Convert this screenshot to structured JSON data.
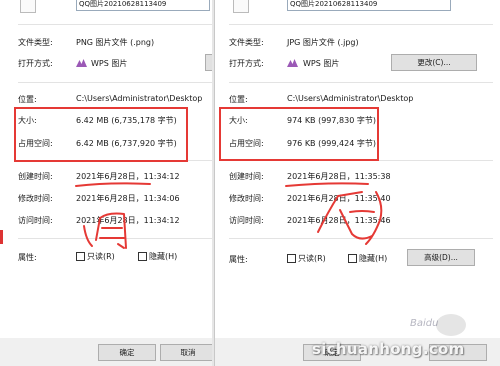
{
  "colors": {
    "annotation": "#e53935",
    "dialog_bg": "#ffffff",
    "button_bg": "#e1e1e1"
  },
  "left": {
    "filename": "QQ图片20210628113409",
    "type_label": "文件类型:",
    "type_value": "PNG 图片文件 (.png)",
    "openwith_label": "打开方式:",
    "openwith_value": "WPS 图片",
    "openwith_icon": "wps-picture-icon",
    "location_label": "位置:",
    "location_value": "C:\\Users\\Administrator\\Desktop",
    "size_label": "大小:",
    "size_value": "6.42 MB (6,735,178 字节)",
    "disk_label": "占用空间:",
    "disk_value": "6.42 MB (6,737,920 字节)",
    "created_label": "创建时间:",
    "created_value": "2021年6月28日，11:34:12",
    "modified_label": "修改时间:",
    "modified_value": "2021年6月28日，11:34:06",
    "accessed_label": "访问时间:",
    "accessed_value": "2021年6月28日，11:34:12",
    "attr_label": "属性:",
    "readonly_label": "只读(R)",
    "hidden_label": "隐藏(H)",
    "ok_label": "确定",
    "cancel_label": "取消"
  },
  "right": {
    "filename": "QQ图片20210628113409",
    "type_label": "文件类型:",
    "type_value": "JPG 图片文件 (.jpg)",
    "openwith_label": "打开方式:",
    "openwith_value": "WPS 图片",
    "openwith_icon": "wps-picture-icon",
    "change_label": "更改(C)...",
    "location_label": "位置:",
    "location_value": "C:\\Users\\Administrator\\Desktop",
    "size_label": "大小:",
    "size_value": "974 KB (997,830 字节)",
    "disk_label": "占用空间:",
    "disk_value": "976 KB (999,424 字节)",
    "created_label": "创建时间:",
    "created_value": "2021年6月28日，11:35:38",
    "modified_label": "修改时间:",
    "modified_value": "2021年6月28日，11:35:40",
    "accessed_label": "访问时间:",
    "accessed_value": "2021年6月28日，11:35:46",
    "attr_label": "属性:",
    "readonly_label": "只读(R)",
    "hidden_label": "隐藏(H)",
    "advanced_label": "高级(D)...",
    "ok_label": "确定"
  },
  "watermark": {
    "site": "sichuanhong.com",
    "baidu": "Baidu"
  }
}
